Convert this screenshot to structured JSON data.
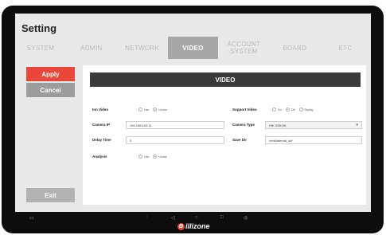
{
  "app": {
    "title": "Setting"
  },
  "tabs": [
    {
      "label": "SYSTEM",
      "active": false
    },
    {
      "label": "ADMIN",
      "active": false
    },
    {
      "label": "NETWORK",
      "active": false
    },
    {
      "label": "VIDEO",
      "active": true
    },
    {
      "label": "ACCOUNT\nSYSTEM",
      "active": false
    },
    {
      "label": "BOARD",
      "active": false
    },
    {
      "label": "ETC",
      "active": false
    }
  ],
  "sidebar": {
    "apply": "Apply",
    "cancel": "Cancel",
    "exit": "Exit"
  },
  "panel": {
    "title": "VIDEO",
    "inn_video": {
      "label": "Inn Video",
      "options": [
        "Use",
        "Unuse"
      ],
      "selected": "Unuse"
    },
    "support_video": {
      "label": "Support Video",
      "options": [
        "On",
        "Off",
        "Replay"
      ],
      "selected": "Off"
    },
    "camera_ip": {
      "label": "Camera IP",
      "value": "192.168.100.11"
    },
    "camera_type": {
      "label": "Camera Type",
      "value": "HIK VISION"
    },
    "delay_time": {
      "label": "Delay Time",
      "value": "3"
    },
    "save_dir": {
      "label": "Save Dir",
      "value": "/mnt/internal_sd/"
    },
    "analysis": {
      "label": "Analysis",
      "options": [
        "Use",
        "Unuse"
      ],
      "selected": "Unuse"
    }
  },
  "brand": {
    "name": "illizone",
    "mark": "B"
  },
  "colors": {
    "accent": "#e8473a",
    "header": "#3a3a3a",
    "tab_active": "#a7a7a7"
  }
}
